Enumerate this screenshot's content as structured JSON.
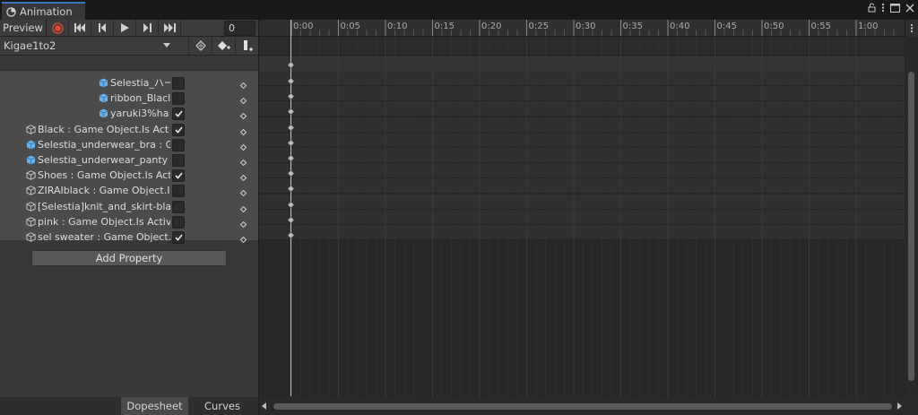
{
  "window": {
    "tab_title": "Animation",
    "colors": {
      "tab_accent": "#3a79bb",
      "record_red": "#e8452c",
      "checkbox_bg": "#2a2a2a"
    }
  },
  "toolbar": {
    "preview_label": "Preview",
    "frame_value": "0",
    "buttons": [
      "record-icon",
      "first-key-icon",
      "prev-key-icon",
      "play-icon",
      "next-key-icon",
      "last-key-icon"
    ]
  },
  "clip": {
    "selected": "Kigae1to2",
    "buttons": [
      "add-keyframe-icon",
      "add-keyframe-plus-icon",
      "add-event-icon"
    ]
  },
  "timeline": {
    "ticks": [
      "0:00",
      "0:05",
      "0:10",
      "0:15",
      "0:20",
      "0:25",
      "0:30",
      "0:35",
      "0:40",
      "0:45",
      "0:50",
      "0:55",
      "1:00"
    ]
  },
  "properties": [
    {
      "label": "Selestia_ハー",
      "icon": "blue-cube-icon",
      "checked": false,
      "indent": 1
    },
    {
      "label": "ribbon_Blacl",
      "icon": "blue-cube-icon",
      "checked": false,
      "indent": 1
    },
    {
      "label": "yaruki3%ha",
      "icon": "blue-cube-icon",
      "checked": true,
      "indent": 1
    },
    {
      "label": "Black : Game Object.Is Act",
      "icon": "gameobject-icon",
      "checked": true,
      "indent": 0
    },
    {
      "label": "Selestia_underwear_bra : G",
      "icon": "blue-cube-icon",
      "checked": false,
      "indent": 0
    },
    {
      "label": "Selestia_underwear_panty",
      "icon": "blue-cube-icon",
      "checked": false,
      "indent": 0
    },
    {
      "label": "Shoes : Game Object.Is Act",
      "icon": "gameobject-icon",
      "checked": true,
      "indent": 0
    },
    {
      "label": "ZIRAIblack : Game Object.I",
      "icon": "gameobject-icon",
      "checked": false,
      "indent": 0
    },
    {
      "label": "[Selestia]knit_and_skirt-bla",
      "icon": "gameobject-icon",
      "checked": false,
      "indent": 0
    },
    {
      "label": "pink : Game Object.Is Activ",
      "icon": "gameobject-icon",
      "checked": false,
      "indent": 0
    },
    {
      "label": "sel sweater : Game Object.",
      "icon": "gameobject-icon",
      "checked": true,
      "indent": 0
    }
  ],
  "add_property_label": "Add Property",
  "bottom_tabs": {
    "dopesheet": "Dopesheet",
    "curves": "Curves",
    "active": "Dopesheet"
  }
}
